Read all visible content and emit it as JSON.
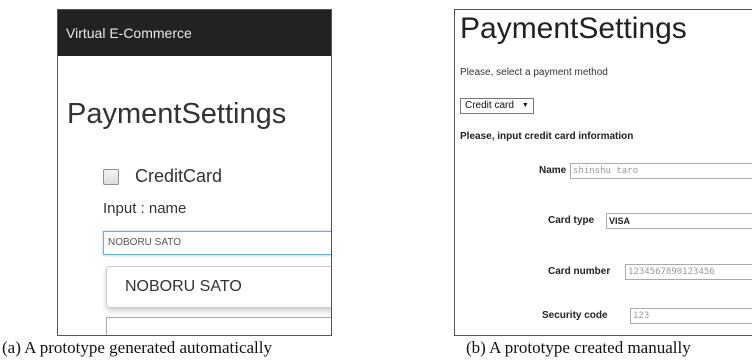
{
  "panel_a": {
    "navbar_title": "Virtual E-Commerce",
    "page_title": "PaymentSettings",
    "checkbox_label": "CreditCard",
    "input_label": "Input : name",
    "name_input_value": "NOBORU SATO",
    "suggestion": "NOBORU SATO",
    "caption": "(a) A prototype generated automatically"
  },
  "panel_b": {
    "page_title": "PaymentSettings",
    "subtitle": "Please, select a payment method",
    "payment_method": "Credit card",
    "section_title": "Please, input credit card information",
    "fields": [
      {
        "label": "Name",
        "value": "shinshu taro"
      },
      {
        "label": "Card type",
        "value": "VISA"
      },
      {
        "label": "Card number",
        "value": "1234567890123456"
      },
      {
        "label": "Security code",
        "value": "123"
      }
    ],
    "caption": "(b) A prototype created manually"
  }
}
